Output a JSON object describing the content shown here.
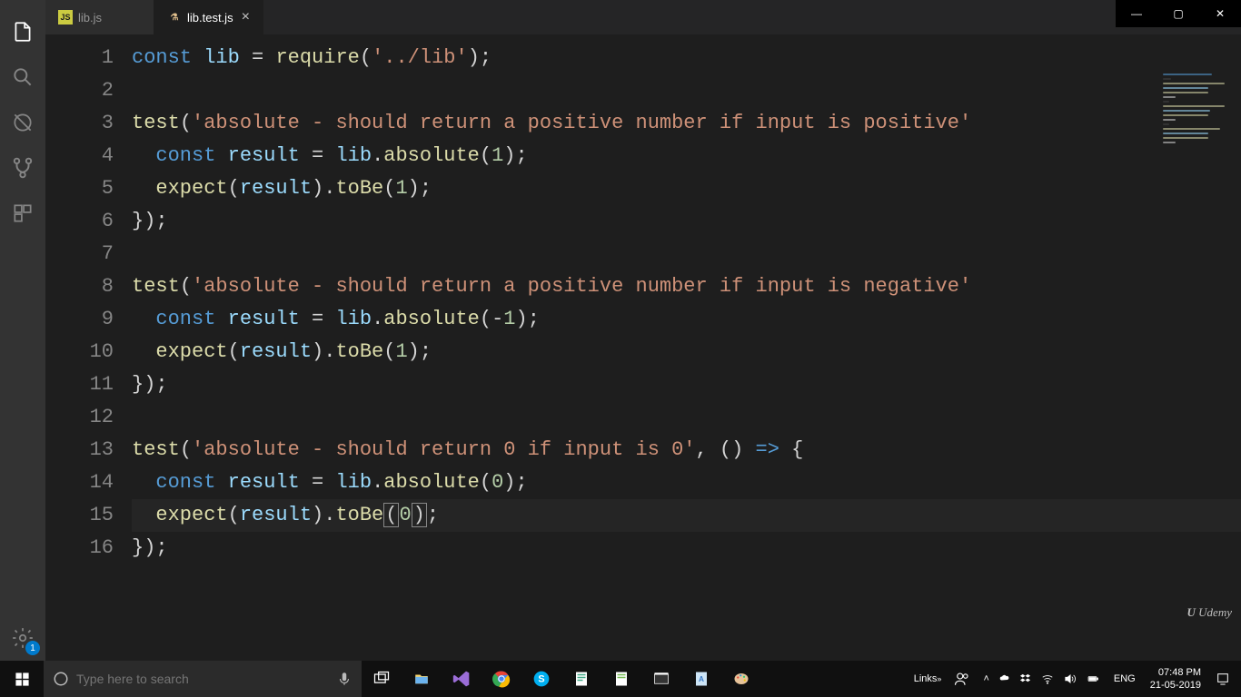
{
  "window": {
    "min": "—",
    "max": "▢",
    "close": "✕"
  },
  "tabs": [
    {
      "icon": "JS",
      "label": "lib.js",
      "active": false
    },
    {
      "icon": "⚗",
      "label": "lib.test.js",
      "active": true
    }
  ],
  "activity": {
    "settings_badge": "1"
  },
  "code": {
    "lines": [
      [
        {
          "t": "kw",
          "v": "const"
        },
        {
          "t": "pun",
          "v": " "
        },
        {
          "t": "var",
          "v": "lib"
        },
        {
          "t": "pun",
          "v": " = "
        },
        {
          "t": "fn",
          "v": "require"
        },
        {
          "t": "pun",
          "v": "("
        },
        {
          "t": "str",
          "v": "'../lib'"
        },
        {
          "t": "pun",
          "v": ");"
        }
      ],
      [],
      [
        {
          "t": "fn",
          "v": "test"
        },
        {
          "t": "pun",
          "v": "("
        },
        {
          "t": "str",
          "v": "'absolute - should return a positive number if input is positive'"
        }
      ],
      [
        {
          "t": "pun",
          "v": "  "
        },
        {
          "t": "kw",
          "v": "const"
        },
        {
          "t": "pun",
          "v": " "
        },
        {
          "t": "var",
          "v": "result"
        },
        {
          "t": "pun",
          "v": " = "
        },
        {
          "t": "var",
          "v": "lib"
        },
        {
          "t": "pun",
          "v": "."
        },
        {
          "t": "fn",
          "v": "absolute"
        },
        {
          "t": "pun",
          "v": "("
        },
        {
          "t": "num",
          "v": "1"
        },
        {
          "t": "pun",
          "v": ");"
        }
      ],
      [
        {
          "t": "pun",
          "v": "  "
        },
        {
          "t": "fn",
          "v": "expect"
        },
        {
          "t": "pun",
          "v": "("
        },
        {
          "t": "var",
          "v": "result"
        },
        {
          "t": "pun",
          "v": ")."
        },
        {
          "t": "fn",
          "v": "toBe"
        },
        {
          "t": "pun",
          "v": "("
        },
        {
          "t": "num",
          "v": "1"
        },
        {
          "t": "pun",
          "v": ");"
        }
      ],
      [
        {
          "t": "pun",
          "v": "});"
        }
      ],
      [],
      [
        {
          "t": "fn",
          "v": "test"
        },
        {
          "t": "pun",
          "v": "("
        },
        {
          "t": "str",
          "v": "'absolute - should return a positive number if input is negative'"
        }
      ],
      [
        {
          "t": "pun",
          "v": "  "
        },
        {
          "t": "kw",
          "v": "const"
        },
        {
          "t": "pun",
          "v": " "
        },
        {
          "t": "var",
          "v": "result"
        },
        {
          "t": "pun",
          "v": " = "
        },
        {
          "t": "var",
          "v": "lib"
        },
        {
          "t": "pun",
          "v": "."
        },
        {
          "t": "fn",
          "v": "absolute"
        },
        {
          "t": "pun",
          "v": "(-"
        },
        {
          "t": "num",
          "v": "1"
        },
        {
          "t": "pun",
          "v": ");"
        }
      ],
      [
        {
          "t": "pun",
          "v": "  "
        },
        {
          "t": "fn",
          "v": "expect"
        },
        {
          "t": "pun",
          "v": "("
        },
        {
          "t": "var",
          "v": "result"
        },
        {
          "t": "pun",
          "v": ")."
        },
        {
          "t": "fn",
          "v": "toBe"
        },
        {
          "t": "pun",
          "v": "("
        },
        {
          "t": "num",
          "v": "1"
        },
        {
          "t": "pun",
          "v": ");"
        }
      ],
      [
        {
          "t": "pun",
          "v": "});"
        }
      ],
      [],
      [
        {
          "t": "fn",
          "v": "test"
        },
        {
          "t": "pun",
          "v": "("
        },
        {
          "t": "str",
          "v": "'absolute - should return 0 if input is 0'"
        },
        {
          "t": "pun",
          "v": ", () "
        },
        {
          "t": "arrow",
          "v": "=>"
        },
        {
          "t": "pun",
          "v": " {"
        }
      ],
      [
        {
          "t": "pun",
          "v": "  "
        },
        {
          "t": "kw",
          "v": "const"
        },
        {
          "t": "pun",
          "v": " "
        },
        {
          "t": "var",
          "v": "result"
        },
        {
          "t": "pun",
          "v": " = "
        },
        {
          "t": "var",
          "v": "lib"
        },
        {
          "t": "pun",
          "v": "."
        },
        {
          "t": "fn",
          "v": "absolute"
        },
        {
          "t": "pun",
          "v": "("
        },
        {
          "t": "num",
          "v": "0"
        },
        {
          "t": "pun",
          "v": ");"
        }
      ],
      [
        {
          "t": "pun",
          "v": "  "
        },
        {
          "t": "fn",
          "v": "expect"
        },
        {
          "t": "pun",
          "v": "("
        },
        {
          "t": "var",
          "v": "result"
        },
        {
          "t": "pun",
          "v": ")."
        },
        {
          "t": "fn",
          "v": "toBe"
        },
        {
          "t": "br",
          "v": "("
        },
        {
          "t": "num",
          "v": "0"
        },
        {
          "t": "br",
          "v": ")"
        },
        {
          "t": "pun",
          "v": ";"
        }
      ],
      [
        {
          "t": "pun",
          "v": "});"
        }
      ]
    ],
    "current_line": 15
  },
  "udemy": "Udemy",
  "taskbar": {
    "search_placeholder": "Type here to search",
    "links": "Links",
    "lang": "ENG",
    "time": "07:48 PM",
    "date": "21-05-2019"
  },
  "minimap_lines": [
    "#569cd6:60",
    "#444:10",
    "#dcdcaa:75",
    "#9cdcfe:55",
    "#dcdcaa:55",
    "#d4d4d4:15",
    "#444:8",
    "#dcdcaa:75",
    "#9cdcfe:58",
    "#dcdcaa:55",
    "#d4d4d4:15",
    "#444:8",
    "#dcdcaa:70",
    "#9cdcfe:55",
    "#dcdcaa:55",
    "#d4d4d4:15"
  ]
}
